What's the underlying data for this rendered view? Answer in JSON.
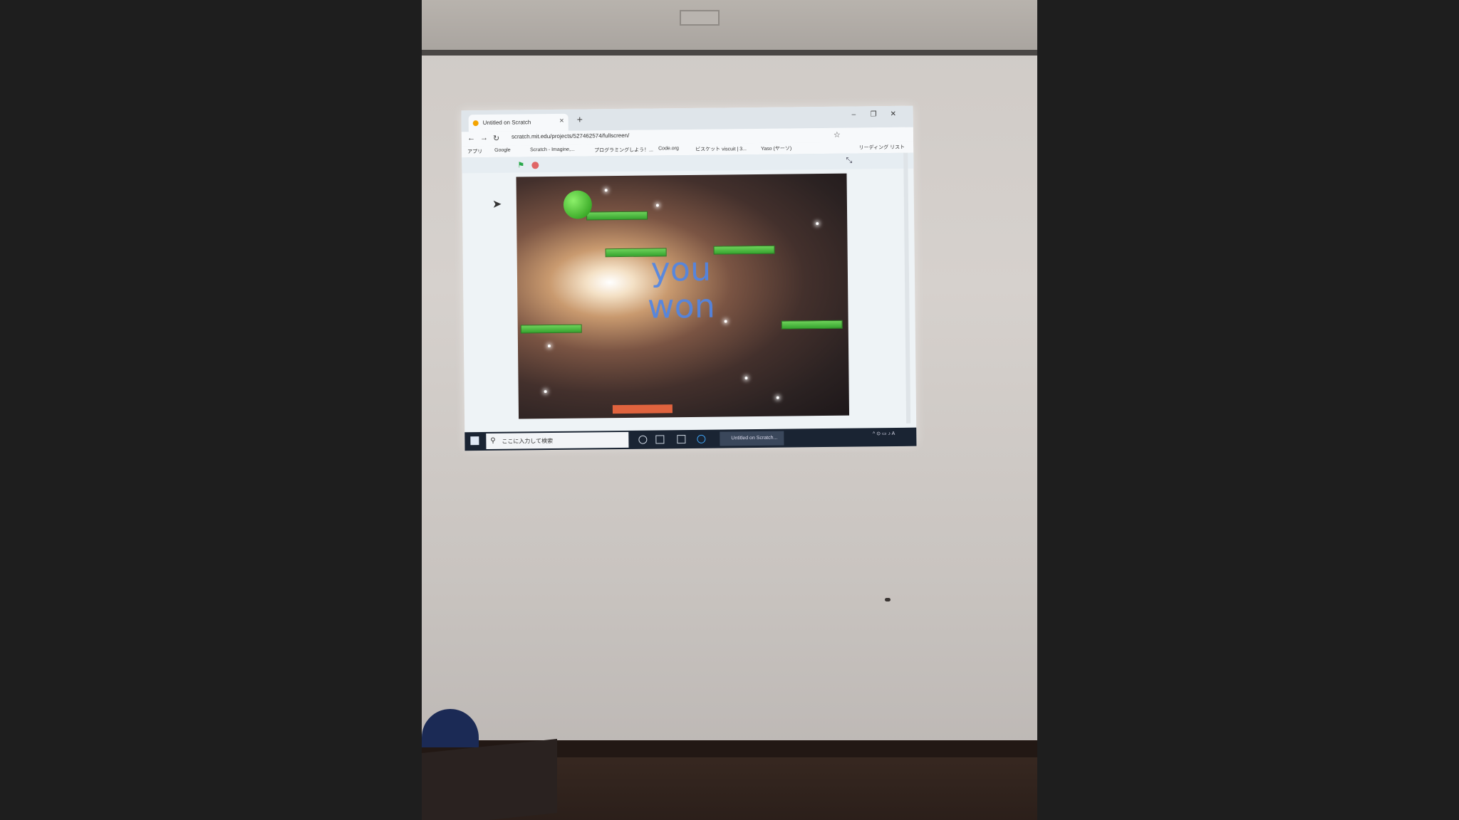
{
  "browser": {
    "tab_title": "Untitled on Scratch",
    "tab_close": "×",
    "new_tab": "+",
    "url": "scratch.mit.edu/projects/527462574/fullscreen/",
    "window_controls": [
      "–",
      "❐",
      "✕"
    ],
    "bookmarks": [
      "アプリ",
      "Google",
      "Scratch - Imagine,...",
      "プログラミングしよう！...",
      "Code.org",
      "ビスケット viscuit | 3...",
      "Yaso (ヤーソ)"
    ],
    "reading_list": "リーディング リスト"
  },
  "scratch_player": {
    "green_flag_icon": "green-flag-icon",
    "stop_icon": "stop-icon",
    "fullscreen_icon": "fullscreen-exit-icon",
    "stage_text": "you\nwon"
  },
  "taskbar": {
    "search_placeholder": "ここに入力して検索",
    "active_app": "Untitled on Scratch..."
  },
  "colors": {
    "platform": "#48b83a",
    "ball": "#5cc83e",
    "paddle": "#e0633e",
    "text": "#4f86e8"
  }
}
